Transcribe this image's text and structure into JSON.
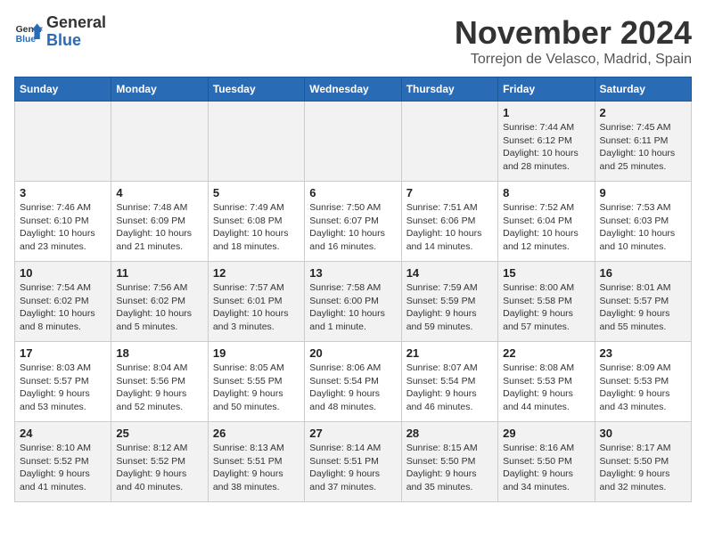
{
  "header": {
    "logo_line1": "General",
    "logo_line2": "Blue",
    "month": "November 2024",
    "location": "Torrejon de Velasco, Madrid, Spain"
  },
  "weekdays": [
    "Sunday",
    "Monday",
    "Tuesday",
    "Wednesday",
    "Thursday",
    "Friday",
    "Saturday"
  ],
  "weeks": [
    [
      {
        "day": "",
        "info": ""
      },
      {
        "day": "",
        "info": ""
      },
      {
        "day": "",
        "info": ""
      },
      {
        "day": "",
        "info": ""
      },
      {
        "day": "",
        "info": ""
      },
      {
        "day": "1",
        "info": "Sunrise: 7:44 AM\nSunset: 6:12 PM\nDaylight: 10 hours and 28 minutes."
      },
      {
        "day": "2",
        "info": "Sunrise: 7:45 AM\nSunset: 6:11 PM\nDaylight: 10 hours and 25 minutes."
      }
    ],
    [
      {
        "day": "3",
        "info": "Sunrise: 7:46 AM\nSunset: 6:10 PM\nDaylight: 10 hours and 23 minutes."
      },
      {
        "day": "4",
        "info": "Sunrise: 7:48 AM\nSunset: 6:09 PM\nDaylight: 10 hours and 21 minutes."
      },
      {
        "day": "5",
        "info": "Sunrise: 7:49 AM\nSunset: 6:08 PM\nDaylight: 10 hours and 18 minutes."
      },
      {
        "day": "6",
        "info": "Sunrise: 7:50 AM\nSunset: 6:07 PM\nDaylight: 10 hours and 16 minutes."
      },
      {
        "day": "7",
        "info": "Sunrise: 7:51 AM\nSunset: 6:06 PM\nDaylight: 10 hours and 14 minutes."
      },
      {
        "day": "8",
        "info": "Sunrise: 7:52 AM\nSunset: 6:04 PM\nDaylight: 10 hours and 12 minutes."
      },
      {
        "day": "9",
        "info": "Sunrise: 7:53 AM\nSunset: 6:03 PM\nDaylight: 10 hours and 10 minutes."
      }
    ],
    [
      {
        "day": "10",
        "info": "Sunrise: 7:54 AM\nSunset: 6:02 PM\nDaylight: 10 hours and 8 minutes."
      },
      {
        "day": "11",
        "info": "Sunrise: 7:56 AM\nSunset: 6:02 PM\nDaylight: 10 hours and 5 minutes."
      },
      {
        "day": "12",
        "info": "Sunrise: 7:57 AM\nSunset: 6:01 PM\nDaylight: 10 hours and 3 minutes."
      },
      {
        "day": "13",
        "info": "Sunrise: 7:58 AM\nSunset: 6:00 PM\nDaylight: 10 hours and 1 minute."
      },
      {
        "day": "14",
        "info": "Sunrise: 7:59 AM\nSunset: 5:59 PM\nDaylight: 9 hours and 59 minutes."
      },
      {
        "day": "15",
        "info": "Sunrise: 8:00 AM\nSunset: 5:58 PM\nDaylight: 9 hours and 57 minutes."
      },
      {
        "day": "16",
        "info": "Sunrise: 8:01 AM\nSunset: 5:57 PM\nDaylight: 9 hours and 55 minutes."
      }
    ],
    [
      {
        "day": "17",
        "info": "Sunrise: 8:03 AM\nSunset: 5:57 PM\nDaylight: 9 hours and 53 minutes."
      },
      {
        "day": "18",
        "info": "Sunrise: 8:04 AM\nSunset: 5:56 PM\nDaylight: 9 hours and 52 minutes."
      },
      {
        "day": "19",
        "info": "Sunrise: 8:05 AM\nSunset: 5:55 PM\nDaylight: 9 hours and 50 minutes."
      },
      {
        "day": "20",
        "info": "Sunrise: 8:06 AM\nSunset: 5:54 PM\nDaylight: 9 hours and 48 minutes."
      },
      {
        "day": "21",
        "info": "Sunrise: 8:07 AM\nSunset: 5:54 PM\nDaylight: 9 hours and 46 minutes."
      },
      {
        "day": "22",
        "info": "Sunrise: 8:08 AM\nSunset: 5:53 PM\nDaylight: 9 hours and 44 minutes."
      },
      {
        "day": "23",
        "info": "Sunrise: 8:09 AM\nSunset: 5:53 PM\nDaylight: 9 hours and 43 minutes."
      }
    ],
    [
      {
        "day": "24",
        "info": "Sunrise: 8:10 AM\nSunset: 5:52 PM\nDaylight: 9 hours and 41 minutes."
      },
      {
        "day": "25",
        "info": "Sunrise: 8:12 AM\nSunset: 5:52 PM\nDaylight: 9 hours and 40 minutes."
      },
      {
        "day": "26",
        "info": "Sunrise: 8:13 AM\nSunset: 5:51 PM\nDaylight: 9 hours and 38 minutes."
      },
      {
        "day": "27",
        "info": "Sunrise: 8:14 AM\nSunset: 5:51 PM\nDaylight: 9 hours and 37 minutes."
      },
      {
        "day": "28",
        "info": "Sunrise: 8:15 AM\nSunset: 5:50 PM\nDaylight: 9 hours and 35 minutes."
      },
      {
        "day": "29",
        "info": "Sunrise: 8:16 AM\nSunset: 5:50 PM\nDaylight: 9 hours and 34 minutes."
      },
      {
        "day": "30",
        "info": "Sunrise: 8:17 AM\nSunset: 5:50 PM\nDaylight: 9 hours and 32 minutes."
      }
    ]
  ]
}
